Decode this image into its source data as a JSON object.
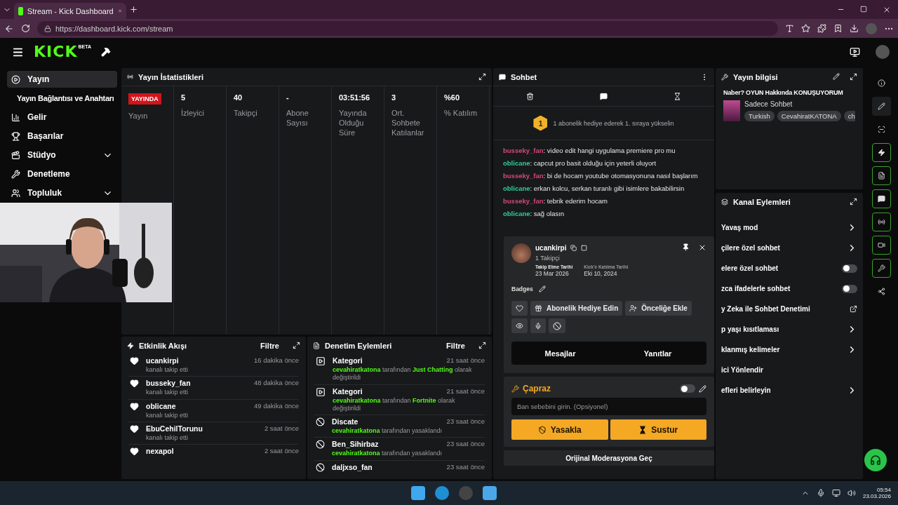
{
  "browser": {
    "tab_title": "Stream - Kick Dashboard",
    "url": "https://dashboard.kick.com/stream"
  },
  "header": {
    "logo": "KICK",
    "logo_badge": "BETA"
  },
  "sidebar": {
    "items": [
      {
        "label": "Yayın",
        "kind": "item",
        "selected": true,
        "expandable": false
      },
      {
        "label": "Yayın Bağlantısı ve Anahtarı",
        "kind": "sub",
        "selected": false,
        "expandable": false
      },
      {
        "label": "Gelir",
        "kind": "item",
        "selected": false,
        "expandable": false
      },
      {
        "label": "Başarılar",
        "kind": "item",
        "selected": false,
        "expandable": false
      },
      {
        "label": "Stüdyo",
        "kind": "item",
        "selected": false,
        "expandable": true
      },
      {
        "label": "Denetleme",
        "kind": "item",
        "selected": false,
        "expandable": false
      },
      {
        "label": "Topluluk",
        "kind": "item",
        "selected": false,
        "expandable": true
      }
    ]
  },
  "stats": {
    "title": "Yayın İstatistikleri",
    "badge": "YAYINDA",
    "badge_label": "Yayın",
    "columns": [
      {
        "value": "5",
        "label": "İzleyici"
      },
      {
        "value": "40",
        "label": "Takipçi"
      },
      {
        "value": "-",
        "label": "Abone Sayısı"
      },
      {
        "value": "03:51:56",
        "label": "Yayında Olduğu Süre"
      },
      {
        "value": "3",
        "label": "Ort. Sohbete Katılanlar"
      },
      {
        "value": "%60",
        "label": "% Katılım"
      }
    ]
  },
  "activity": {
    "title": "Etkinlik Akışı",
    "filter": "Filtre",
    "events": [
      {
        "user": "ucankirpi",
        "text": "kanalı takip etti",
        "time": "16 dakika önce"
      },
      {
        "user": "busseky_fan",
        "text": "kanalı takip etti",
        "time": "48 dakika önce"
      },
      {
        "user": "oblicane",
        "text": "kanalı takip etti",
        "time": "49 dakika önce"
      },
      {
        "user": "EbuCehilTorunu",
        "text": "kanalı takip etti",
        "time": "2 saat önce"
      },
      {
        "user": "nexapol",
        "time": "2 saat önce"
      }
    ]
  },
  "mod_log": {
    "title": "Denetim Eylemleri",
    "filter": "Filtre",
    "entries": [
      {
        "kind": "category",
        "title": "Kategori",
        "time": "21 saat önce",
        "parts": [
          {
            "text": "cevahiratkatona",
            "highlight": true
          },
          {
            "text": " tarafından ",
            "highlight": false
          },
          {
            "text": "Just Chatting",
            "highlight": true
          },
          {
            "text": " olarak değiştirildi",
            "highlight": false
          }
        ]
      },
      {
        "kind": "category",
        "title": "Kategori",
        "time": "21 saat önce",
        "parts": [
          {
            "text": "cevahiratkatona",
            "highlight": true
          },
          {
            "text": " tarafından ",
            "highlight": false
          },
          {
            "text": "Fortnite",
            "highlight": true
          },
          {
            "text": " olarak değiştirildi",
            "highlight": false
          }
        ]
      },
      {
        "kind": "ban",
        "title": "Discate",
        "time": "23 saat önce",
        "parts": [
          {
            "text": "cevahiratkatona",
            "highlight": true
          },
          {
            "text": " tarafından yasaklandı",
            "highlight": false
          }
        ]
      },
      {
        "kind": "ban",
        "title": "Ben_Sihirbaz",
        "time": "23 saat önce",
        "parts": [
          {
            "text": "cevahiratkatona",
            "highlight": true
          },
          {
            "text": " tarafından yasaklandı",
            "highlight": false
          }
        ]
      },
      {
        "kind": "ban",
        "title": "daljxso_fan",
        "time": "23 saat önce"
      }
    ]
  },
  "chat": {
    "title": "Sohbet",
    "gift_rank": "1",
    "gift_text": "1 abonelik hediye ederek 1. sıraya yükselin",
    "messages": [
      {
        "user": "busseky_fan",
        "text": ": video edit hangi uygulama premiere pro mu",
        "color": "#d24a74"
      },
      {
        "user": "oblicane",
        "text": ": capcut pro basit olduğu için yeterli oluyort",
        "color": "#2ecf96"
      },
      {
        "user": "busseky_fan",
        "text": ": bi de hocam youtube otomasyonuna nasıl başlarım",
        "color": "#d24a74"
      },
      {
        "user": "oblicane",
        "text": ": erkan kolcu, serkan turanlı gibi isimlere bakabilirsin",
        "color": "#2ecf96"
      },
      {
        "user": "busseky_fan",
        "text": ": tebrik ederim hocam",
        "color": "#d24a74"
      },
      {
        "user": "oblicane",
        "text": ": sağ olasın",
        "color": "#2ecf96"
      }
    ]
  },
  "user_card": {
    "username": "ucankirpi",
    "followers": "1 Takipçi",
    "dates": [
      {
        "label": "Takip Etme Tarihi",
        "value": "23 Mar 2026"
      },
      {
        "label": "Kick'e Katılma Tarihi",
        "value": "Eki 10, 2024"
      }
    ],
    "badges_label": "Badges",
    "actions": [
      "Abonelik Hediye Edin",
      "Önceliğe Ekle"
    ],
    "tabs": [
      "Mesajlar",
      "Yanıtlar"
    ]
  },
  "moderation": {
    "title": "Çapraz",
    "on": false,
    "reason_placeholder": "Ban sebebini girin. (Opsiyonel)",
    "ban_button": "Yasakla",
    "timeout_button": "Sustur",
    "footer": "Orijinal Moderasyona Geç"
  },
  "stream_info": {
    "title": "Yayın bilgisi",
    "stream_title": "Naber? OYUN Hakkında KONUŞUYORUM",
    "category": "Sadece Sohbet",
    "tags": [
      "Turkish",
      "CevahiratKATONA",
      "ch"
    ]
  },
  "channel_actions": {
    "title": "Kanal Eylemleri",
    "items": [
      {
        "label": "Yavaş mod",
        "kind": "chevron"
      },
      {
        "label": "çilere özel sohbet",
        "kind": "chevron"
      },
      {
        "label": "elere özel sohbet",
        "kind": "toggle",
        "on": false
      },
      {
        "label": "zca ifadelerle sohbet",
        "kind": "toggle",
        "on": false
      },
      {
        "label": "y Zeka ile Sohbet Denetimi",
        "kind": "external"
      },
      {
        "label": "p yaşı kısıtlaması",
        "kind": "chevron"
      },
      {
        "label": "klanmış kelimeler",
        "kind": "chevron"
      },
      {
        "label": "ici Yönlendir",
        "kind": "plain"
      },
      {
        "label": "efleri belirleyin",
        "kind": "chevron"
      }
    ]
  },
  "taskbar": {
    "time": "05:54",
    "date": "23.03.2026"
  }
}
